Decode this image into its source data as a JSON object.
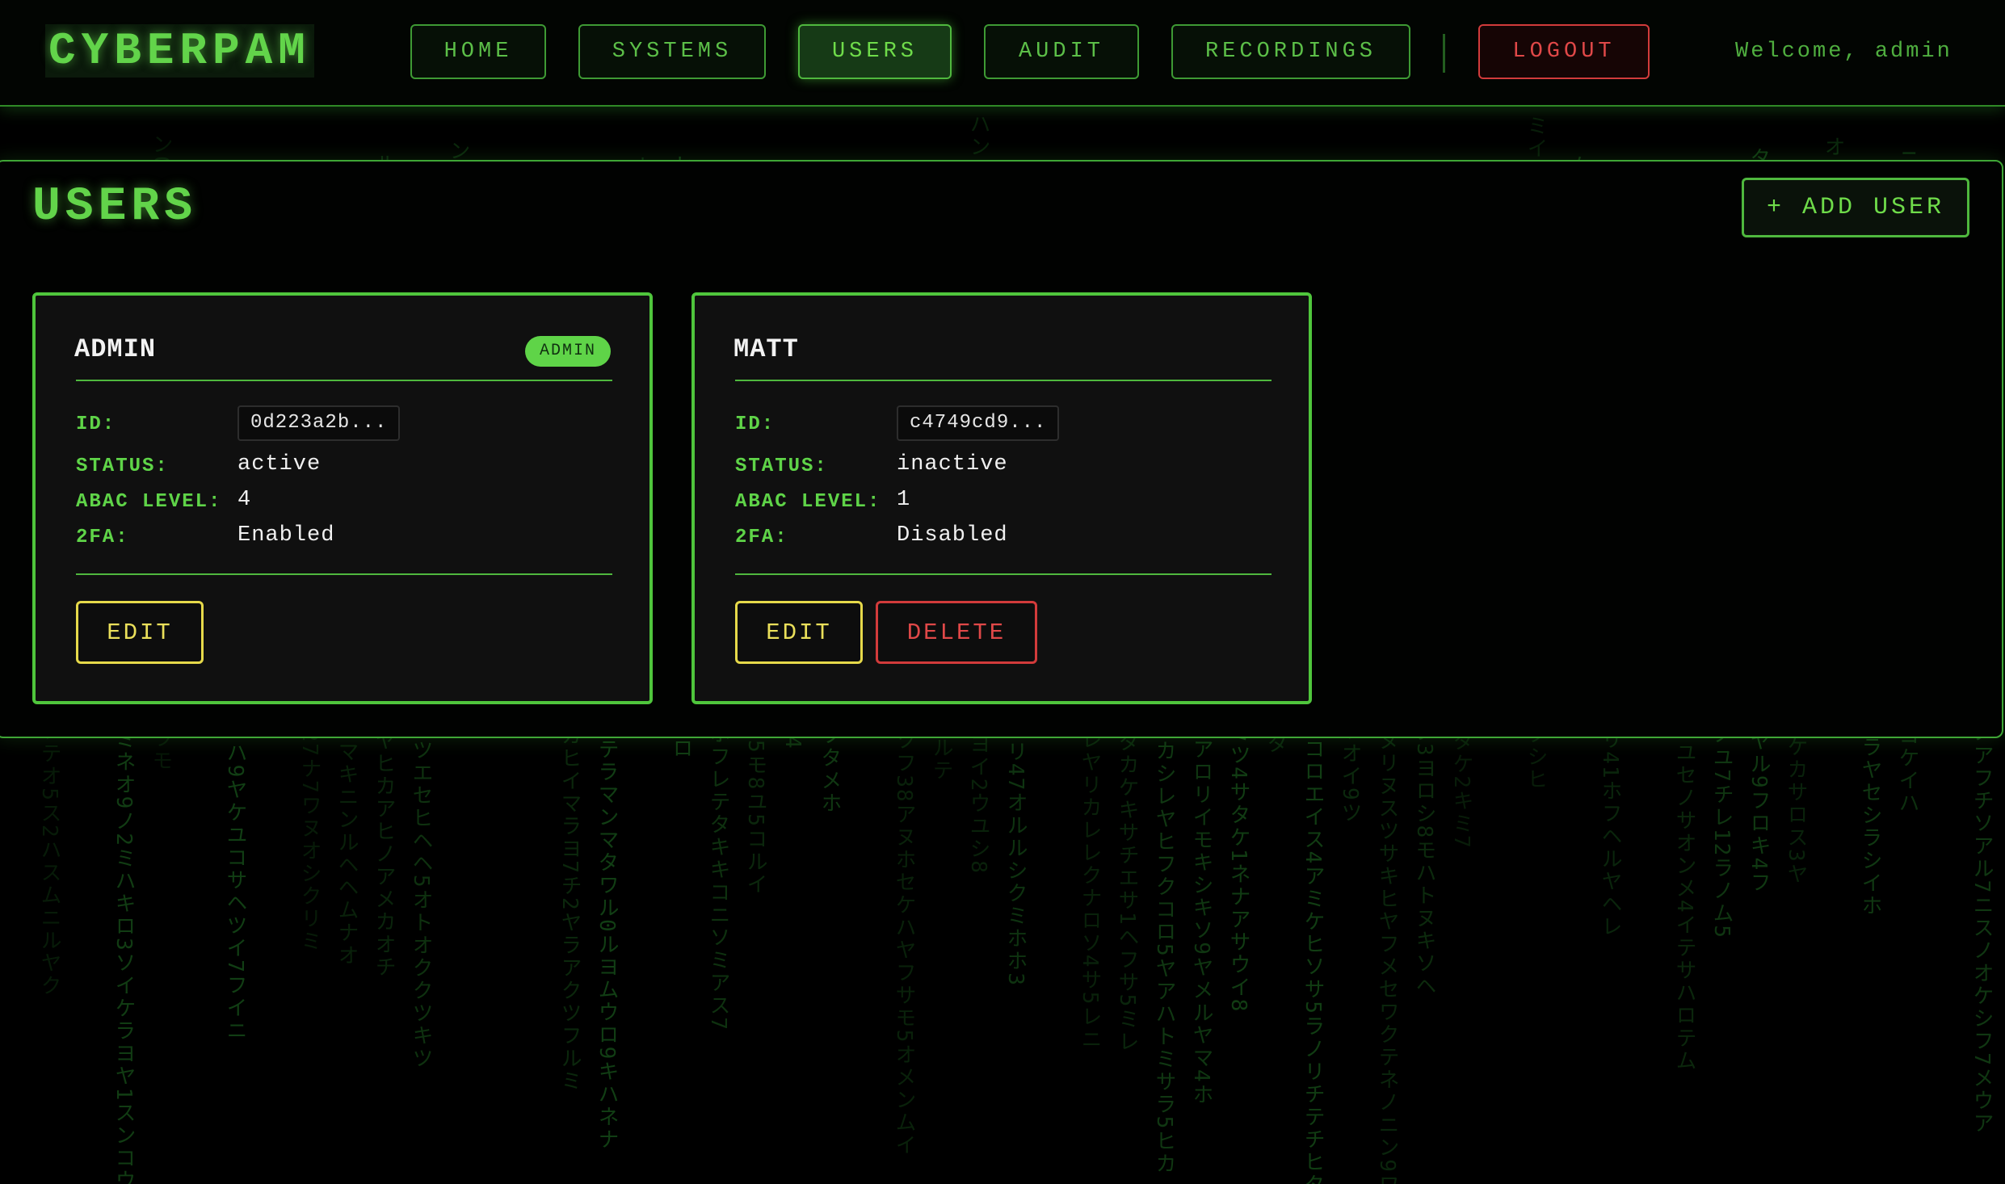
{
  "app": {
    "logo": "CYBERPAM"
  },
  "nav": {
    "items": [
      {
        "label": "HOME",
        "active": false
      },
      {
        "label": "SYSTEMS",
        "active": false
      },
      {
        "label": "USERS",
        "active": true
      },
      {
        "label": "AUDIT",
        "active": false
      },
      {
        "label": "RECORDINGS",
        "active": false
      }
    ],
    "logout_label": "LOGOUT",
    "welcome_text": "Welcome, admin"
  },
  "page": {
    "title": "USERS",
    "add_user_label": "+ ADD USER"
  },
  "field_labels": {
    "id": "ID:",
    "status": "STATUS:",
    "abac_level": "ABAC LEVEL:",
    "twofa": "2FA:"
  },
  "users": [
    {
      "name": "ADMIN",
      "role_badge": "ADMIN",
      "id": "0d223a2b...",
      "status": "active",
      "abac_level": "4",
      "twofa": "Enabled",
      "edit_label": "EDIT"
    },
    {
      "name": "MATT",
      "id": "c4749cd9...",
      "status": "inactive",
      "abac_level": "1",
      "twofa": "Disabled",
      "edit_label": "EDIT",
      "delete_label": "DELETE"
    }
  ],
  "colors": {
    "accent": "#5fd448",
    "danger": "#d23b3b",
    "edit": "#e6d94a",
    "background": "#000000"
  }
}
